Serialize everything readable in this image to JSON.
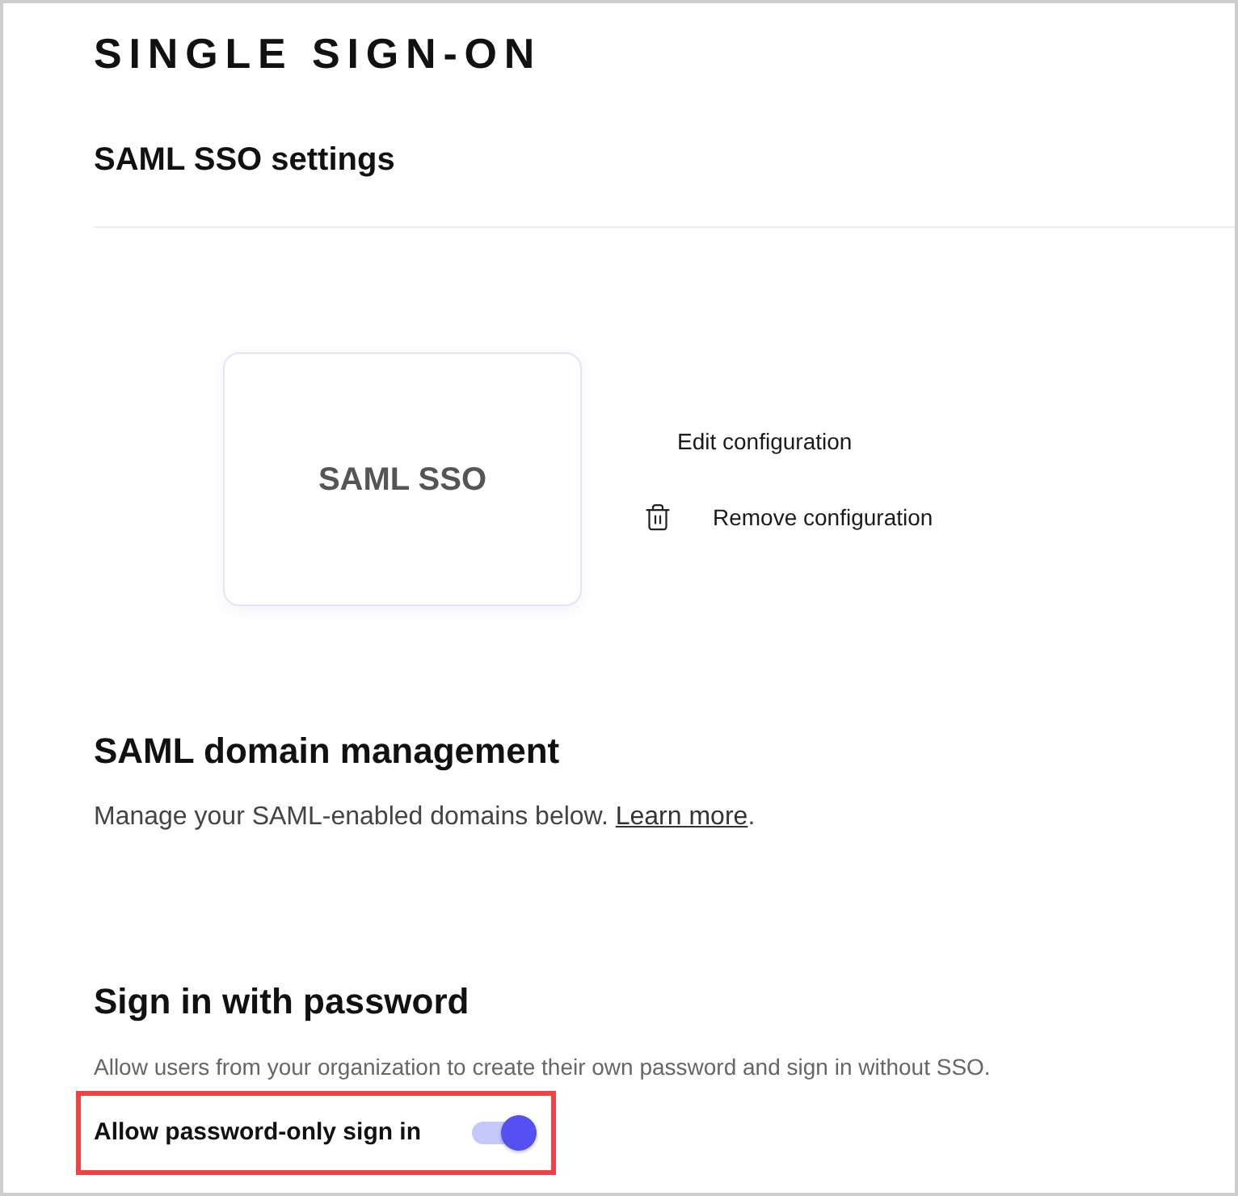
{
  "page": {
    "title": "SINGLE SIGN-ON"
  },
  "saml_settings": {
    "heading": "SAML SSO settings",
    "card": {
      "label": "SAML SSO"
    },
    "actions": [
      {
        "kind": "edit",
        "label": "Edit configuration"
      },
      {
        "kind": "delete",
        "label": "Remove configuration"
      }
    ]
  },
  "domain_management": {
    "heading": "SAML domain management",
    "description": "Manage your SAML-enabled domains below. ",
    "link": "Learn more",
    "link_suffix": "."
  },
  "password_signin": {
    "heading": "Sign in with password",
    "description": "Allow users from your organization to create their own password and sign in without SSO.",
    "toggle": {
      "label": "Allow password-only sign in",
      "on": true,
      "highlighted": true
    }
  }
}
